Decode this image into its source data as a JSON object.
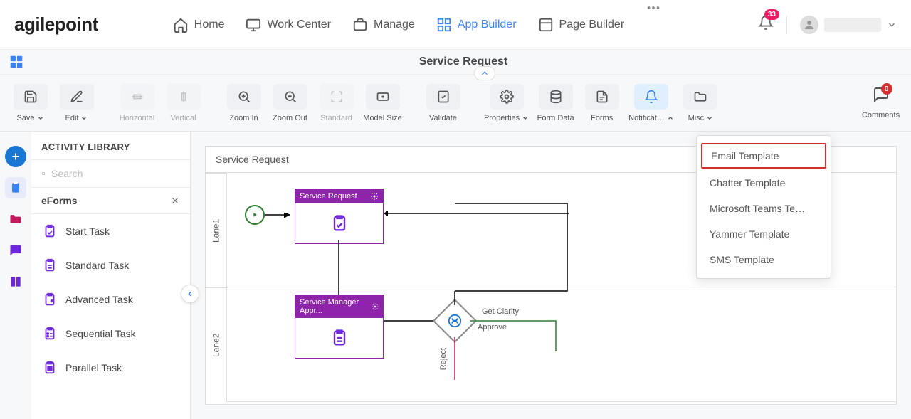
{
  "logo": "agilepoint",
  "nav": {
    "home": "Home",
    "work_center": "Work Center",
    "manage": "Manage",
    "app_builder": "App Builder",
    "page_builder": "Page Builder"
  },
  "header": {
    "notification_count": "33"
  },
  "context": {
    "title": "Service Request"
  },
  "toolbar": {
    "save": "Save",
    "edit": "Edit",
    "horizontal": "Horizontal",
    "vertical": "Vertical",
    "zoom_in": "Zoom In",
    "zoom_out": "Zoom Out",
    "standard": "Standard",
    "model_size": "Model Size",
    "validate": "Validate",
    "properties": "Properties",
    "form_data": "Form Data",
    "forms": "Forms",
    "notifications": "Notificat…",
    "misc": "Misc",
    "comments": "Comments",
    "comments_count": "0"
  },
  "dropdown": {
    "items": [
      "Email Template",
      "Chatter Template",
      "Microsoft Teams Te…",
      "Yammer Template",
      "SMS Template"
    ]
  },
  "library": {
    "title": "ACTIVITY LIBRARY",
    "search_placeholder": "Search",
    "category": "eForms",
    "items": [
      "Start Task",
      "Standard Task",
      "Advanced Task",
      "Sequential Task",
      "Parallel Task"
    ]
  },
  "canvas": {
    "title": "Service Request",
    "lanes": [
      "Lane1",
      "Lane2"
    ],
    "activities": {
      "a1": "Service Request",
      "a2": "Service Manager Appr..."
    },
    "edges": {
      "get_clarity": "Get Clarity",
      "approve": "Approve",
      "reject": "Reject"
    }
  }
}
